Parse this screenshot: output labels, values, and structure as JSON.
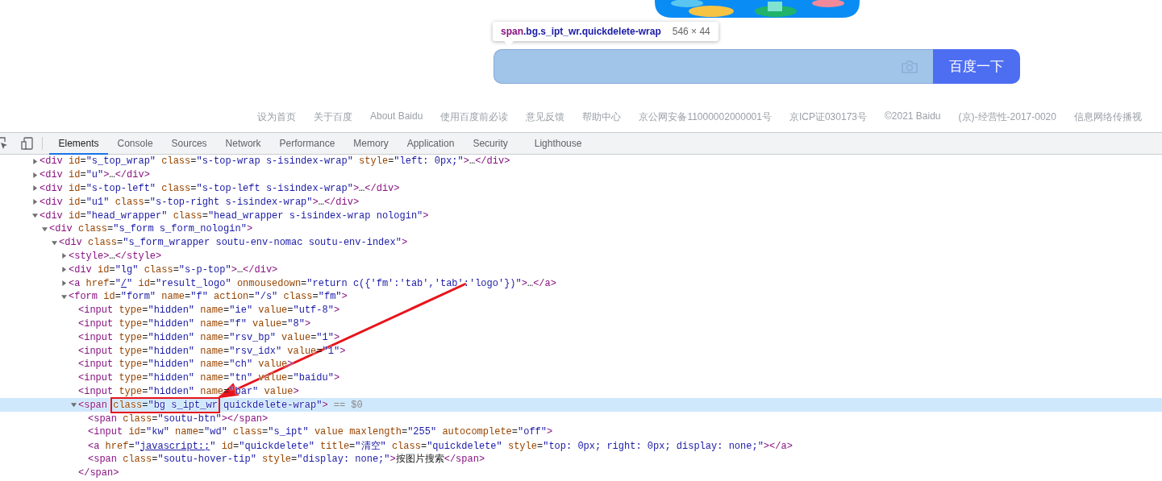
{
  "page": {
    "search_button": "百度一下",
    "tooltip": {
      "tag": "span",
      "classes": ".bg.s_ipt_wr.quickdelete-wrap",
      "size": "546 × 44"
    },
    "footer_links": [
      "设为首页",
      "关于百度",
      "About Baidu",
      "使用百度前必读",
      "意见反馈",
      "帮助中心",
      "京公网安备11000002000001号",
      "京ICP证030173号",
      "©2021 Baidu",
      "(京)-经营性-2017-0020",
      "信息网络传播视"
    ]
  },
  "devtools": {
    "tabs": [
      {
        "label": "Elements",
        "selected": true
      },
      {
        "label": "Console",
        "selected": false
      },
      {
        "label": "Sources",
        "selected": false
      },
      {
        "label": "Network",
        "selected": false
      },
      {
        "label": "Performance",
        "selected": false
      },
      {
        "label": "Memory",
        "selected": false
      },
      {
        "label": "Application",
        "selected": false
      },
      {
        "label": "Security",
        "selected": false
      },
      {
        "label": "Lighthouse",
        "selected": false
      }
    ],
    "tree": [
      {
        "kind": "branch",
        "expanded": false,
        "selected": false,
        "segments": [
          {
            "kind": "code",
            "text": "<div id=\"s_top_wrap\" class=\"s-top-wrap s-isindex-wrap\" style=\"left: 0px;\">…</div>"
          }
        ]
      },
      {
        "kind": "branch",
        "expanded": false,
        "selected": false,
        "segments": [
          {
            "kind": "code",
            "text": "<div id=\"u\">…</div>"
          }
        ]
      },
      {
        "kind": "branch",
        "expanded": false,
        "selected": false,
        "segments": [
          {
            "kind": "code",
            "text": "<div id=\"s-top-left\" class=\"s-top-left s-isindex-wrap\">…</div>"
          }
        ]
      },
      {
        "kind": "branch",
        "expanded": false,
        "selected": false,
        "segments": [
          {
            "kind": "code",
            "text": "<div id=\"u1\" class=\"s-top-right s-isindex-wrap\">…</div>"
          }
        ]
      },
      {
        "kind": "branch",
        "expanded": true,
        "selected": false,
        "segments": [
          {
            "kind": "code",
            "text": "<div id=\"head_wrapper\" class=\"head_wrapper s-isindex-wrap nologin\">"
          }
        ],
        "children": [
          {
            "kind": "branch",
            "expanded": true,
            "selected": false,
            "segments": [
              {
                "kind": "code",
                "text": "<div class=\"s_form s_form_nologin\">"
              }
            ],
            "children": [
              {
                "kind": "branch",
                "expanded": true,
                "selected": false,
                "segments": [
                  {
                    "kind": "code",
                    "text": "<div class=\"s_form_wrapper soutu-env-nomac soutu-env-index\">"
                  }
                ],
                "children": [
                  {
                    "kind": "branch",
                    "expanded": false,
                    "selected": false,
                    "segments": [
                      {
                        "kind": "code",
                        "text": "<style>…</style>"
                      }
                    ]
                  },
                  {
                    "kind": "branch",
                    "expanded": false,
                    "selected": false,
                    "segments": [
                      {
                        "kind": "code",
                        "text": "<div id=\"lg\" class=\"s-p-top\">…</div>"
                      }
                    ]
                  },
                  {
                    "kind": "branch",
                    "expanded": false,
                    "selected": false,
                    "segments": [
                      {
                        "kind": "code",
                        "text": "<a href=\""
                      },
                      {
                        "kind": "link",
                        "text": "/"
                      },
                      {
                        "kind": "code",
                        "text": "\" id=\"result_logo\" onmousedown=\"return c({'fm':'tab','tab':'logo'})\">…</a>"
                      }
                    ]
                  },
                  {
                    "kind": "branch",
                    "expanded": true,
                    "selected": false,
                    "segments": [
                      {
                        "kind": "code",
                        "text": "<form id=\"form\" name=\"f\" action=\"/s\" class=\"fm\">"
                      }
                    ],
                    "children": [
                      {
                        "kind": "leaf",
                        "selected": false,
                        "segments": [
                          {
                            "kind": "code",
                            "text": "<input type=\"hidden\" name=\"ie\" value=\"utf-8\">"
                          }
                        ]
                      },
                      {
                        "kind": "leaf",
                        "selected": false,
                        "segments": [
                          {
                            "kind": "code",
                            "text": "<input type=\"hidden\" name=\"f\" value=\"8\">"
                          }
                        ]
                      },
                      {
                        "kind": "leaf",
                        "selected": false,
                        "segments": [
                          {
                            "kind": "code",
                            "text": "<input type=\"hidden\" name=\"rsv_bp\" value=\"1\">"
                          }
                        ]
                      },
                      {
                        "kind": "leaf",
                        "selected": false,
                        "segments": [
                          {
                            "kind": "code",
                            "text": "<input type=\"hidden\" name=\"rsv_idx\" value=\"1\">"
                          }
                        ]
                      },
                      {
                        "kind": "leaf",
                        "selected": false,
                        "segments": [
                          {
                            "kind": "code",
                            "text": "<input type=\"hidden\" name=\"ch\" value>"
                          }
                        ]
                      },
                      {
                        "kind": "leaf",
                        "selected": false,
                        "segments": [
                          {
                            "kind": "code",
                            "text": "<input type=\"hidden\" name=\"tn\" value=\"baidu\">"
                          }
                        ]
                      },
                      {
                        "kind": "leaf",
                        "selected": false,
                        "segments": [
                          {
                            "kind": "code",
                            "text": "<input type=\"hidden\" name=\"bar\" value>"
                          }
                        ]
                      },
                      {
                        "kind": "branch",
                        "expanded": true,
                        "selected": true,
                        "suffix": "== $0",
                        "closing": "</span>",
                        "segments": [
                          {
                            "kind": "code",
                            "text": "<span class=\"bg s_ipt_wr quickdelete-wrap\">"
                          }
                        ],
                        "children": [
                          {
                            "kind": "leaf",
                            "selected": false,
                            "segments": [
                              {
                                "kind": "code",
                                "text": "<span class=\"soutu-btn\"></span>"
                              }
                            ]
                          },
                          {
                            "kind": "leaf",
                            "selected": false,
                            "segments": [
                              {
                                "kind": "code",
                                "text": "<input id=\"kw\" name=\"wd\" class=\"s_ipt\" value maxlength=\"255\" autocomplete=\"off\">"
                              }
                            ]
                          },
                          {
                            "kind": "leaf",
                            "selected": false,
                            "segments": [
                              {
                                "kind": "code",
                                "text": "<a href=\""
                              },
                              {
                                "kind": "link",
                                "text": "javascript:;"
                              },
                              {
                                "kind": "code",
                                "text": "\" id=\"quickdelete\" title=\"清空\" class=\"quickdelete\" style=\"top: 0px; right: 0px; display: none;\"></a>"
                              }
                            ]
                          },
                          {
                            "kind": "leaf",
                            "selected": false,
                            "segments": [
                              {
                                "kind": "code",
                                "text": "<span class=\"soutu-hover-tip\" style=\"display: none;\">按图片搜索</span>"
                              }
                            ]
                          }
                        ]
                      }
                    ]
                  }
                ]
              }
            ]
          }
        ]
      }
    ]
  }
}
